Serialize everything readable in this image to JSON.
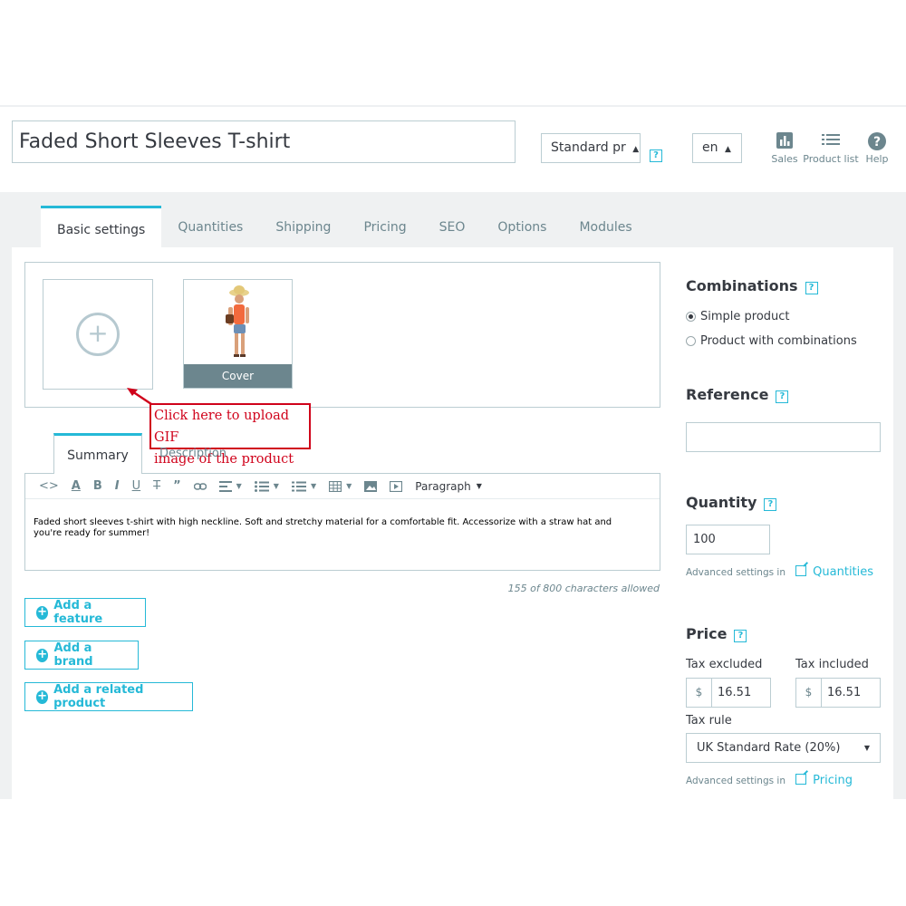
{
  "header": {
    "product_name": "Faded Short Sleeves T-shirt",
    "product_type": "Standard pr",
    "language": "en",
    "help_glyph": "?",
    "actions": [
      {
        "label": "Sales",
        "icon": "bar-chart-icon"
      },
      {
        "label": "Product list",
        "icon": "list-icon"
      },
      {
        "label": "Help",
        "icon": "help-circle-icon"
      }
    ]
  },
  "tabs": [
    "Basic settings",
    "Quantities",
    "Shipping",
    "Pricing",
    "SEO",
    "Options",
    "Modules"
  ],
  "images": {
    "upload_glyph": "+",
    "cover_label": "Cover"
  },
  "annotation": {
    "text_line1": "Click here to upload GIF",
    "text_line2": "image of the product",
    "color": "#d0021b"
  },
  "editor": {
    "tabs": [
      "Summary",
      "Description"
    ],
    "format_label": "Paragraph",
    "content": "Faded short sleeves t-shirt with high neckline. Soft and stretchy material for a comfortable fit. Accessorize with a straw hat and you're ready for summer!",
    "char_count": "155 of 800 characters allowed"
  },
  "buttons": {
    "add_feature": "Add a feature",
    "add_brand": "Add a brand",
    "add_related": "Add a related product"
  },
  "combinations": {
    "title": "Combinations",
    "options": [
      "Simple product",
      "Product with combinations"
    ],
    "selected": "Simple product"
  },
  "reference": {
    "title": "Reference",
    "value": ""
  },
  "quantity": {
    "title": "Quantity",
    "value": "100",
    "advanced_text": "Advanced settings in",
    "advanced_link": "Quantities"
  },
  "price": {
    "title": "Price",
    "tax_excluded_label": "Tax excluded",
    "tax_included_label": "Tax included",
    "currency": "$",
    "tax_excluded_value": "16.51",
    "tax_included_value": "16.51",
    "tax_rule_label": "Tax rule",
    "tax_rule_value": "UK Standard Rate (20%)",
    "advanced_text": "Advanced settings in",
    "advanced_link": "Pricing"
  },
  "colors": {
    "accent": "#25b9d7",
    "border": "#bbcdd2",
    "muted": "#6c868e",
    "band": "#eff1f2"
  }
}
